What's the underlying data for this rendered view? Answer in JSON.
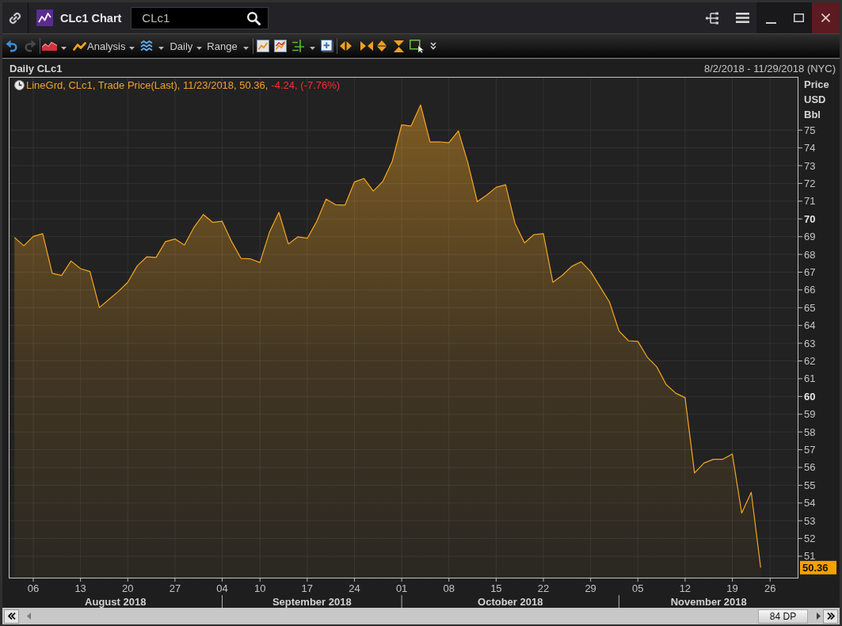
{
  "title_bar": {
    "title": "CLc1 Chart",
    "search": {
      "value": "CLc1"
    }
  },
  "toolbar": {
    "redo_disabled": true,
    "menus": [
      "Analysis",
      "Daily",
      "Range"
    ]
  },
  "chart_panel": {
    "date_range": "8/2/2018 - 11/29/2018 (NYC)",
    "legend": {
      "description": "LineGrd, CLc1, Trade Price(Last), 11/23/2018, 50.36,",
      "change": "-4.24, (-7.76%)",
      "change_negative": true
    },
    "last_price_tag": "50.36",
    "month_labels": [
      "August 2018",
      "September 2018",
      "October 2018",
      "November 2018"
    ],
    "chart_data": {
      "type": "area",
      "title": "Daily CLc1",
      "ylabel": "Price USD Bbl",
      "color": "#f5a623",
      "grid": true,
      "ylim": [
        49.75,
        78
      ],
      "categories": [
        null,
        null,
        "06",
        null,
        null,
        null,
        null,
        "13",
        null,
        null,
        null,
        null,
        "20",
        null,
        null,
        null,
        null,
        "27",
        null,
        null,
        null,
        null,
        "04",
        null,
        null,
        null,
        "10",
        null,
        null,
        null,
        null,
        "17",
        null,
        null,
        null,
        null,
        "24",
        null,
        null,
        null,
        null,
        "01",
        null,
        null,
        null,
        null,
        "08",
        null,
        null,
        null,
        null,
        "15",
        null,
        null,
        null,
        null,
        "22",
        null,
        null,
        null,
        null,
        "29",
        null,
        null,
        null,
        null,
        "05",
        null,
        null,
        null,
        null,
        "12",
        null,
        null,
        null,
        null,
        "19",
        null,
        null,
        null,
        "26",
        null,
        null,
        null
      ],
      "values": [
        68.96,
        68.49,
        69.01,
        69.17,
        66.94,
        66.81,
        67.63,
        67.2,
        67.04,
        65.01,
        65.46,
        65.91,
        66.43,
        67.35,
        67.86,
        67.83,
        68.72,
        68.87,
        68.53,
        69.51,
        70.25,
        69.8,
        69.87,
        68.72,
        67.77,
        67.75,
        67.54,
        69.25,
        70.37,
        68.59,
        68.99,
        68.91,
        69.85,
        71.12,
        70.8,
        70.78,
        72.08,
        72.28,
        71.57,
        72.12,
        73.25,
        75.3,
        75.23,
        76.41,
        74.33,
        74.34,
        74.29,
        74.96,
        73.17,
        70.97,
        71.34,
        71.78,
        71.92,
        69.75,
        68.65,
        69.12,
        69.17,
        66.43,
        66.82,
        67.33,
        67.59,
        67.04,
        66.18,
        65.31,
        63.69,
        63.14,
        63.1,
        62.21,
        61.67,
        60.67,
        60.19,
        59.93,
        55.69,
        56.25,
        56.46,
        56.46,
        56.76,
        53.43,
        54.6,
        50.36,
        null,
        null,
        null,
        null
      ],
      "yticks": [
        51,
        52,
        53,
        54,
        55,
        56,
        57,
        58,
        59,
        60,
        61,
        62,
        63,
        64,
        65,
        66,
        67,
        68,
        69,
        70,
        71,
        72,
        73,
        74,
        75
      ]
    }
  },
  "scrollbar": {
    "points_label": "84 DP"
  }
}
